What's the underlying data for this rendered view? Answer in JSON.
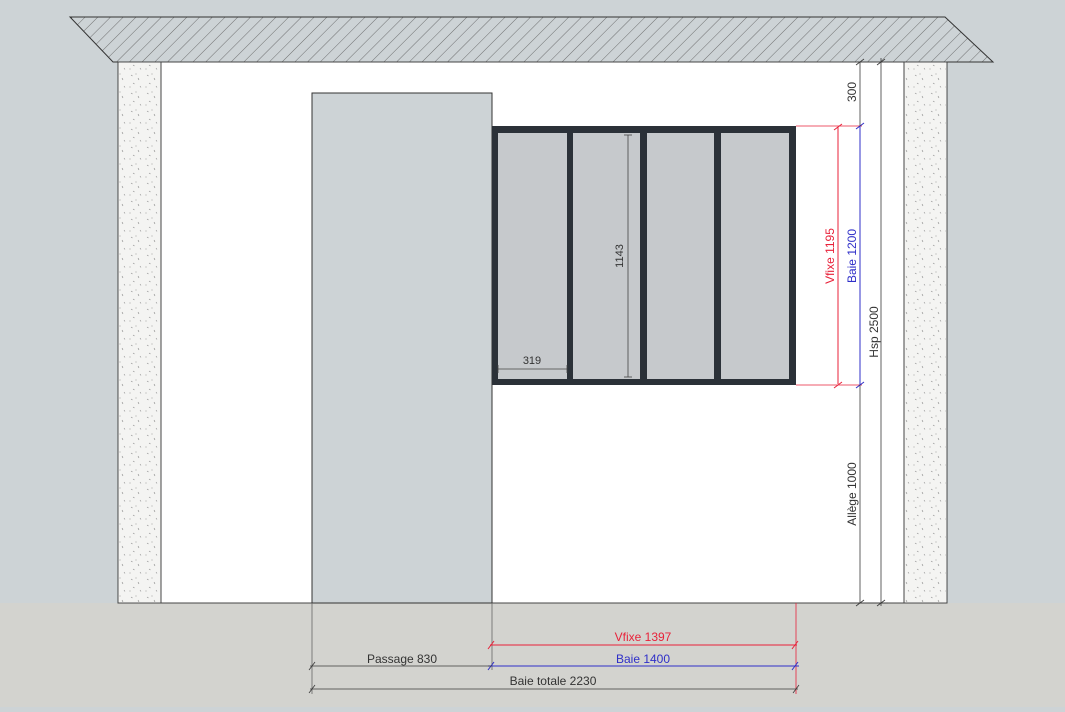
{
  "drawing": {
    "colors": {
      "background": "#cdd3d6",
      "floor": "#d3d3cf",
      "wall": "#ffffff",
      "insulation": "#f4f4f2",
      "door": "#cdd3d6",
      "glass": "#c6c9cc",
      "frame": "#2b3138",
      "red_dim": "#e8223a",
      "blue_dim": "#2f2fc8",
      "grey_dim": "#3a3a3a"
    },
    "dims": {
      "top_300": "300",
      "vfixe_vertical": "Vfixe 1195",
      "baie_vertical": "Baie 1200",
      "hsp": "Hsp 2500",
      "allege": "Allège 1000",
      "pane_height": "1143",
      "pane_width": "319",
      "vfixe_horizontal": "Vfixe 1397",
      "baie_horizontal": "Baie 1400",
      "passage": "Passage 830",
      "baie_totale": "Baie totale 2230"
    }
  }
}
